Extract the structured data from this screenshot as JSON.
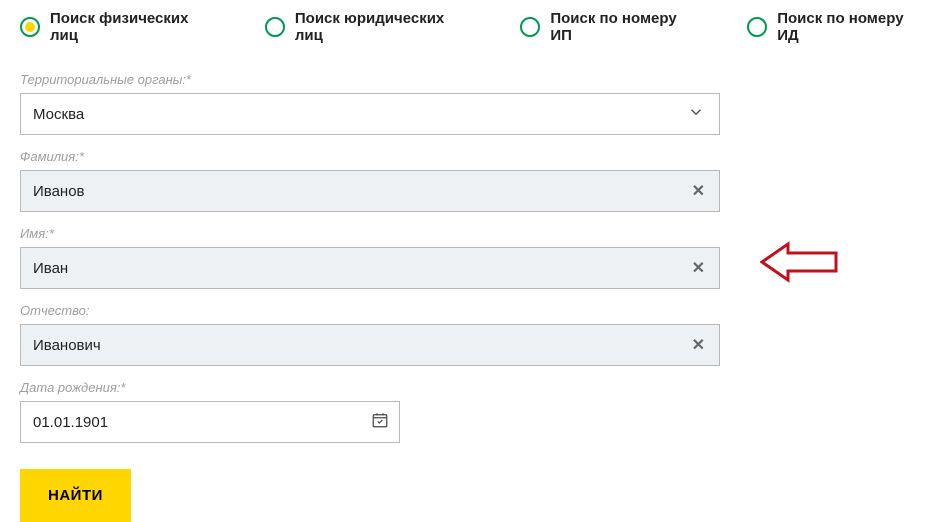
{
  "tabs": [
    {
      "label": "Поиск физических лиц",
      "selected": true
    },
    {
      "label": "Поиск юридических лиц",
      "selected": false
    },
    {
      "label": "Поиск по номеру ИП",
      "selected": false
    },
    {
      "label": "Поиск по номеру ИД",
      "selected": false
    }
  ],
  "fields": {
    "region": {
      "label": "Территориальные органы:*",
      "value": "Москва"
    },
    "surname": {
      "label": "Фамилия:*",
      "value": "Иванов"
    },
    "name": {
      "label": "Имя:*",
      "value": "Иван"
    },
    "patronymic": {
      "label": "Отчество:",
      "value": "Иванович"
    },
    "birthdate": {
      "label": "Дата рождения:*",
      "value": "01.01.1901"
    }
  },
  "submit_label": "НАЙТИ"
}
